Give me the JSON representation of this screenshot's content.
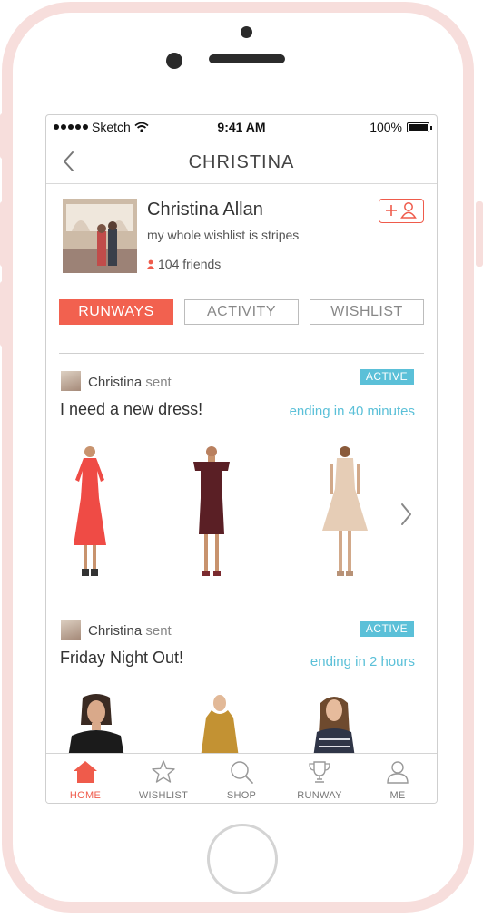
{
  "status_bar": {
    "carrier": "Sketch",
    "time": "9:41 AM",
    "battery": "100%"
  },
  "nav": {
    "title": "CHRISTINA"
  },
  "profile": {
    "name": "Christina Allan",
    "bio": "my whole wishlist is stripes",
    "friends": "104 friends"
  },
  "tabs": [
    {
      "label": "RUNWAYS"
    },
    {
      "label": "ACTIVITY"
    },
    {
      "label": "WISHLIST"
    }
  ],
  "posts": [
    {
      "sender": "Christina",
      "verb": "sent",
      "badge": "ACTIVE",
      "title": "I need a new dress!",
      "ending": "ending in 40 minutes",
      "products": [
        {
          "color": "#ef4b45"
        },
        {
          "color": "#5a1f25"
        },
        {
          "color": "#e6cdb6"
        }
      ]
    },
    {
      "sender": "Christina",
      "verb": "sent",
      "badge": "ACTIVE",
      "title": "Friday Night Out!",
      "ending": "ending in 2 hours",
      "products": [
        {
          "color": "#1b1b1b"
        },
        {
          "color": "#c39233"
        },
        {
          "color": "#2f3547"
        }
      ]
    }
  ],
  "tab_bar": [
    {
      "label": "HOME",
      "icon": "home-icon"
    },
    {
      "label": "WISHLIST",
      "icon": "star-icon"
    },
    {
      "label": "SHOP",
      "icon": "search-icon"
    },
    {
      "label": "RUNWAY",
      "icon": "trophy-icon"
    },
    {
      "label": "ME",
      "icon": "user-icon"
    }
  ],
  "colors": {
    "accent": "#f2614f",
    "badge": "#5bc0d8",
    "frame": "#f7dedc"
  }
}
